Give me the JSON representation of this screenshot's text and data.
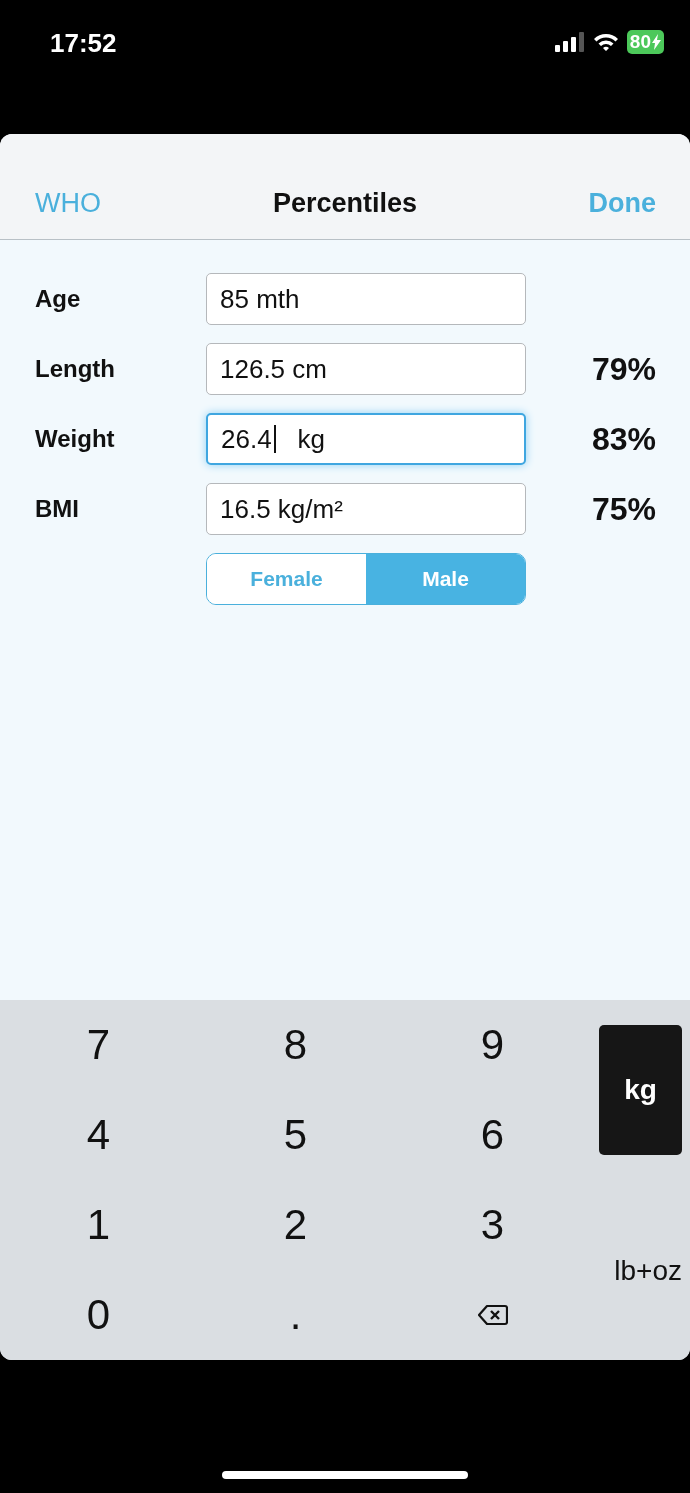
{
  "status_bar": {
    "time": "17:52",
    "battery": "80"
  },
  "nav": {
    "left": "WHO",
    "title": "Percentiles",
    "right": "Done"
  },
  "fields": [
    {
      "label": "Age",
      "value": "85 mth",
      "focused": false
    },
    {
      "label": "Length",
      "value": "126.5 cm",
      "focused": false,
      "percentile": "79%"
    },
    {
      "label": "Weight",
      "value": "26.4",
      "unit": "kg",
      "focused": true,
      "percentile": "83%"
    },
    {
      "label": "BMI",
      "value": "16.5 kg/m²",
      "focused": false,
      "percentile": "75%"
    }
  ],
  "sex": [
    {
      "label": "Female",
      "selected": false
    },
    {
      "label": "Male",
      "selected": true
    }
  ],
  "keypad": {
    "keys": [
      {
        "kind": "digit",
        "label": "7"
      },
      {
        "kind": "digit",
        "label": "8"
      },
      {
        "kind": "digit",
        "label": "9"
      },
      {
        "kind": "digit",
        "label": "4"
      },
      {
        "kind": "digit",
        "label": "5"
      },
      {
        "kind": "digit",
        "label": "6"
      },
      {
        "kind": "digit",
        "label": "1"
      },
      {
        "kind": "digit",
        "label": "2"
      },
      {
        "kind": "digit",
        "label": "3"
      },
      {
        "kind": "digit",
        "label": "0"
      },
      {
        "kind": "digit",
        "label": "."
      },
      {
        "kind": "backspace"
      }
    ],
    "units": [
      {
        "label": "kg",
        "selected": true
      },
      {
        "label": "lb+oz",
        "selected": false
      }
    ]
  }
}
